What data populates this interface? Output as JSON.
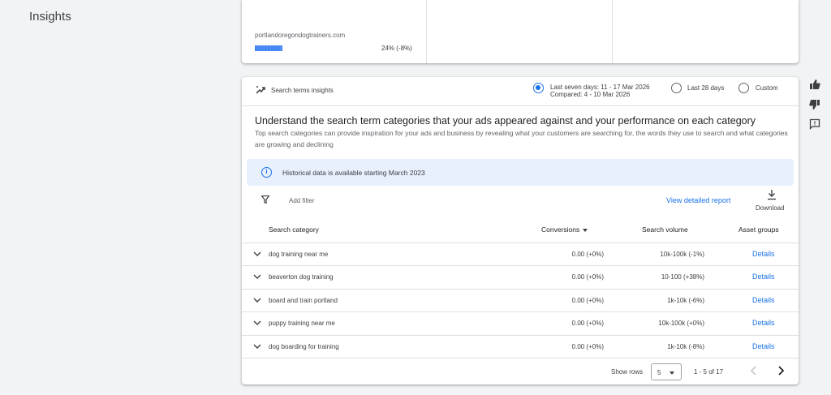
{
  "page": {
    "title": "Insights"
  },
  "top_card": {
    "domain": "portlandoregondogtrainers.com",
    "bar_fill_percent": 24,
    "percent_text": "24% (-8%)"
  },
  "search_insights": {
    "title": "Search terms insights",
    "date_options": [
      {
        "label": "Last seven days: 11 - 17 Mar 2026",
        "sub": "Compared: 4 - 10 Mar 2026",
        "selected": true
      },
      {
        "label": "Last 28 days",
        "selected": false
      },
      {
        "label": "Custom",
        "selected": false
      }
    ],
    "heading": "Understand the search term categories that your ads appeared against and your performance on each category",
    "description": "Top search categories can provide inspiration for your ads and business by revealing what your customers are searching for, the words they use to search and what categories are growing and declining",
    "info_banner": "Historical data is available starting March 2023",
    "add_filter": "Add filter",
    "view_report": "View detailed report",
    "download": "Download",
    "columns": {
      "category": "Search category",
      "conversions": "Conversions",
      "volume": "Search volume",
      "assets": "Asset groups"
    },
    "rows": [
      {
        "category": "dog training near me",
        "conversions": "0.00 (+0%)",
        "volume": "10k-100k (-1%)",
        "details": "Details"
      },
      {
        "category": "beaverton dog training",
        "conversions": "0.00 (+0%)",
        "volume": "10-100 (+38%)",
        "details": "Details"
      },
      {
        "category": "board and train portland",
        "conversions": "0.00 (+0%)",
        "volume": "1k-10k (-6%)",
        "details": "Details"
      },
      {
        "category": "puppy training near me",
        "conversions": "0.00 (+0%)",
        "volume": "10k-100k (+0%)",
        "details": "Details"
      },
      {
        "category": "dog boarding for training",
        "conversions": "0.00 (+0%)",
        "volume": "1k-10k (-8%)",
        "details": "Details"
      }
    ],
    "pagination": {
      "show_rows_label": "Show rows",
      "rows_value": "5",
      "range": "1 - 5 of 17"
    }
  },
  "side_actions": [
    "thumbs-up-icon",
    "thumbs-down-icon",
    "feedback-icon"
  ],
  "colors": {
    "accent": "#1a73e8",
    "bar": "#4285f4",
    "info_bg": "#e8f0fe"
  }
}
